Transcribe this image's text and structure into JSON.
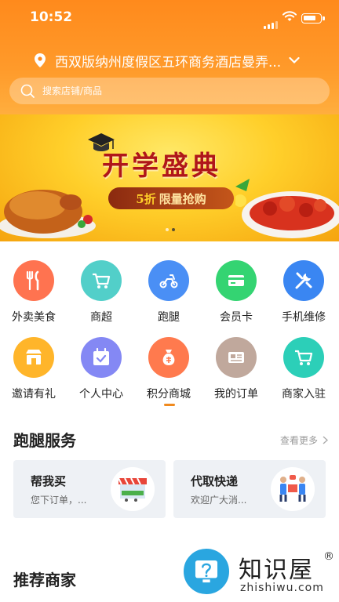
{
  "status_bar": {
    "time": "10:52"
  },
  "location": {
    "text": "西双版纳州度假区五环商务酒店曼弄..."
  },
  "search": {
    "placeholder": "搜索店铺/商品"
  },
  "banner": {
    "title": "开学盛典",
    "discount": "5折",
    "deal_text": "限量抢购",
    "slide_count": 2,
    "active_slide": 2
  },
  "grid": {
    "items": [
      {
        "label": "外卖美食",
        "icon": "fork-knife-icon",
        "color": "#ff7350"
      },
      {
        "label": "商超",
        "icon": "cart-icon",
        "color": "#52cfc9"
      },
      {
        "label": "跑腿",
        "icon": "scooter-icon",
        "color": "#4a8ff5"
      },
      {
        "label": "会员卡",
        "icon": "card-icon",
        "color": "#34d472"
      },
      {
        "label": "手机维修",
        "icon": "tools-icon",
        "color": "#3a86f2"
      },
      {
        "label": "邀请有礼",
        "icon": "shop-icon",
        "color": "#ffb52a"
      },
      {
        "label": "个人中心",
        "icon": "calendar-check-icon",
        "color": "#8488f4"
      },
      {
        "label": "积分商城",
        "icon": "money-bag-icon",
        "color": "#ff7a4e"
      },
      {
        "label": "我的订单",
        "icon": "id-card-icon",
        "color": "#c0a89c"
      },
      {
        "label": "商家入驻",
        "icon": "cart-icon",
        "color": "#2ccfb8"
      }
    ]
  },
  "errand": {
    "title": "跑腿服务",
    "more": "查看更多",
    "cards": [
      {
        "title": "帮我买",
        "subtitle": "您下订单，..."
      },
      {
        "title": "代取快递",
        "subtitle": "欢迎广大消..."
      }
    ]
  },
  "recommend": {
    "title": "推荐商家"
  },
  "watermark": {
    "text_zh": "知识屋",
    "text_en": "zhishiwu.com",
    "reg": "®"
  },
  "colors": {
    "brand": "#ff8a1c",
    "accent": "#f08a1e"
  }
}
